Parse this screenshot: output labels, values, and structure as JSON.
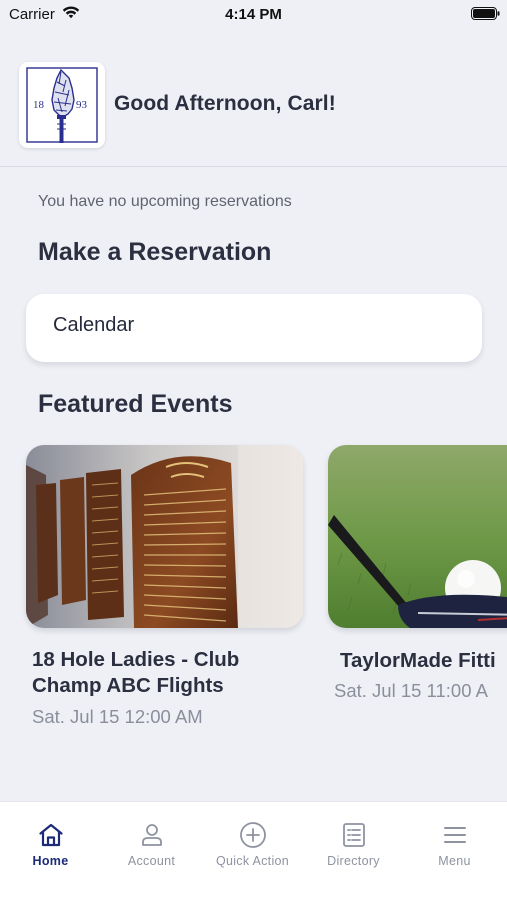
{
  "status_bar": {
    "carrier": "Carrier",
    "time": "4:14 PM"
  },
  "header": {
    "greeting": "Good Afternoon, Carl!",
    "logo_year_left": "18",
    "logo_year_right": "93"
  },
  "reservations": {
    "empty_message": "You have no upcoming reservations",
    "section_title": "Make a Reservation",
    "calendar_label": "Calendar"
  },
  "events": {
    "section_title": "Featured Events",
    "items": [
      {
        "title": "18 Hole Ladies - Club Champ ABC Flights",
        "date": "Sat. Jul 15 12:00 AM"
      },
      {
        "title": "TaylorMade Fitti",
        "date": "Sat. Jul 15 11:00 A"
      }
    ]
  },
  "tab_bar": {
    "tabs": [
      {
        "label": "Home",
        "icon": "home-icon",
        "active": true
      },
      {
        "label": "Account",
        "icon": "person-icon",
        "active": false
      },
      {
        "label": "Quick Action",
        "icon": "plus-circle-icon",
        "active": false
      },
      {
        "label": "Directory",
        "icon": "list-icon",
        "active": false
      },
      {
        "label": "Menu",
        "icon": "hamburger-icon",
        "active": false
      }
    ]
  },
  "colors": {
    "accent": "#1c2a78",
    "background": "#eef0f5",
    "inactive": "#8e93a0",
    "logo_ink": "#2a2f8f"
  }
}
